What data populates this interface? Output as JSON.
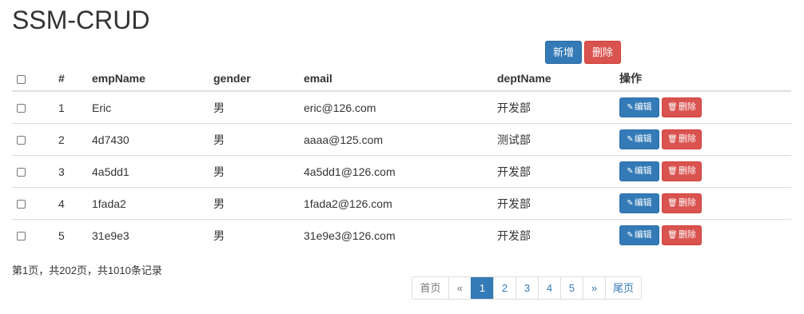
{
  "title": "SSM-CRUD",
  "actions": {
    "add_label": "新增",
    "delete_label": "删除"
  },
  "columns": [
    "#",
    "empName",
    "gender",
    "email",
    "deptName",
    "操作"
  ],
  "rows": [
    {
      "id": "1",
      "empName": "Eric",
      "gender": "男",
      "email": "eric@126.com",
      "deptName": "开发部"
    },
    {
      "id": "2",
      "empName": "4d7430",
      "gender": "男",
      "email": "aaaa@125.com",
      "deptName": "测试部"
    },
    {
      "id": "3",
      "empName": "4a5dd1",
      "gender": "男",
      "email": "4a5dd1@126.com",
      "deptName": "开发部"
    },
    {
      "id": "4",
      "empName": "1fada2",
      "gender": "男",
      "email": "1fada2@126.com",
      "deptName": "开发部"
    },
    {
      "id": "5",
      "empName": "31e9e3",
      "gender": "男",
      "email": "31e9e3@126.com",
      "deptName": "开发部"
    }
  ],
  "row_actions": {
    "edit_label": "编辑",
    "delete_label": "删除",
    "edit_icon": "pencil-icon",
    "delete_icon": "trash-icon"
  },
  "page_info": "第1页，共202页，共1010条记录",
  "pagination": {
    "first": "首页",
    "prev": "«",
    "next": "»",
    "last": "尾页",
    "pages": [
      "1",
      "2",
      "3",
      "4",
      "5"
    ],
    "current": "1"
  },
  "colors": {
    "primary": "#337ab7",
    "danger": "#d9534f"
  }
}
